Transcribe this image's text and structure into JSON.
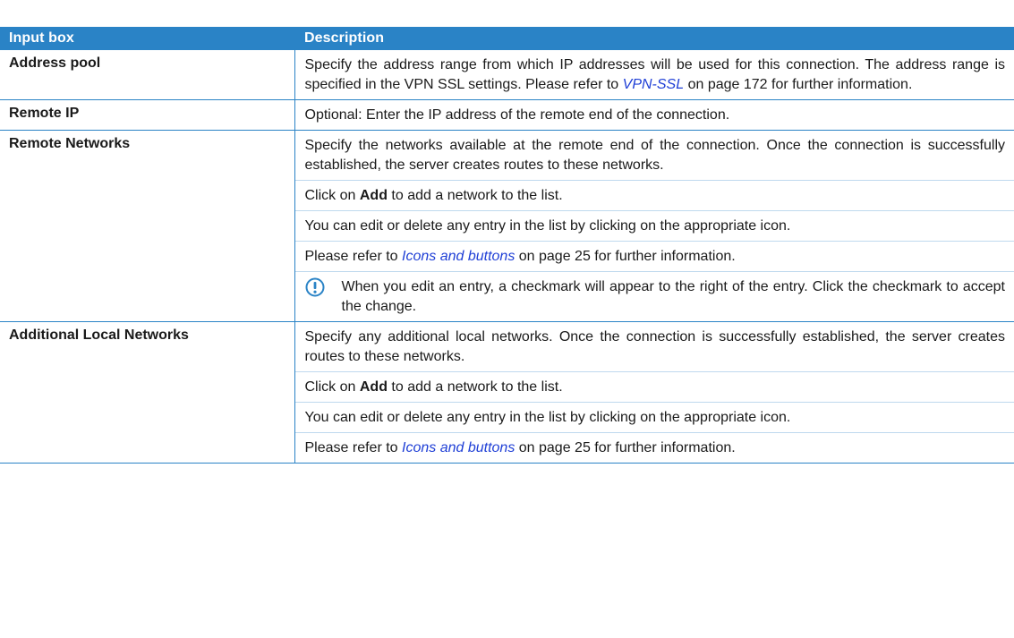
{
  "table": {
    "header": {
      "col1": "Input box",
      "col2": "Description"
    },
    "rows": [
      {
        "label": "Address pool",
        "paras": [
          {
            "before": "Specify the address range from which IP addresses will be used for this connection. The address range is specified in the VPN SSL settings. Please refer to ",
            "link": "VPN-SSL",
            "after": " on page 172 for further information."
          }
        ]
      },
      {
        "label": "Remote IP",
        "paras": [
          {
            "text": "Optional: Enter the IP address of the remote end of the connection."
          }
        ]
      },
      {
        "label": "Remote Networks",
        "paras": [
          {
            "text": "Specify the networks available at the remote end of the connection. Once the connection is successfully established, the server creates routes to these networks."
          },
          {
            "before": "Click on ",
            "bold": "Add",
            "after": " to add a network to the list."
          },
          {
            "text": "You can edit or delete any entry in the list by clicking on the appropriate icon."
          },
          {
            "before": "Please refer to ",
            "link": "Icons and buttons",
            "after": " on page 25 for further information."
          }
        ],
        "note": {
          "icon": "exclamation-circle-icon",
          "text": "When you edit an entry, a checkmark will appear to the right of the entry. Click the checkmark to accept the change."
        }
      },
      {
        "label": "Additional Local Networks",
        "paras": [
          {
            "text": "Specify any additional local networks. Once the connection is successfully established, the server creates routes to these networks."
          },
          {
            "before": "Click on ",
            "bold": "Add",
            "after": " to add a network to the list."
          },
          {
            "text": "You can edit or delete any entry in the list by clicking on the appropriate icon."
          },
          {
            "before": "Please refer to ",
            "link": "Icons and buttons",
            "after": " on page 25 for further information."
          }
        ]
      }
    ]
  },
  "colors": {
    "header_bg": "#2a83c6",
    "link": "#1f3fd6",
    "icon": "#2a83c6"
  }
}
